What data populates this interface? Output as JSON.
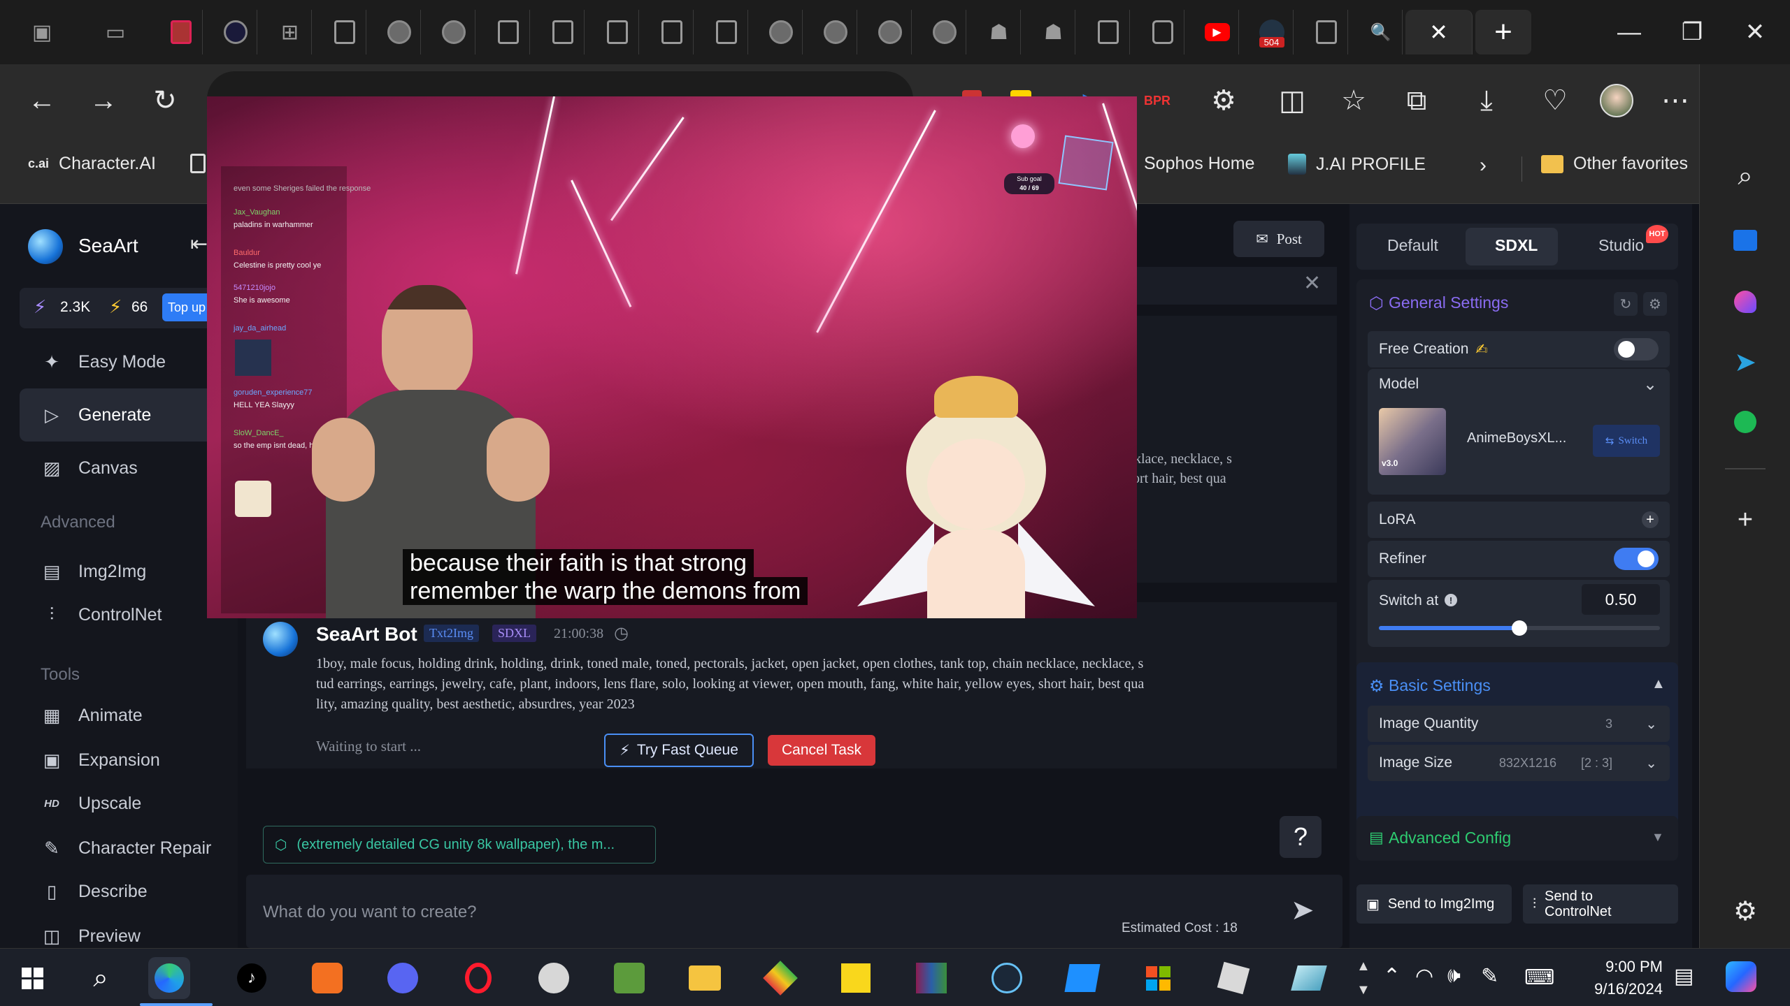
{
  "browser": {
    "favorites": {
      "character_ai": "Character.AI",
      "character_ai_short": "c.ai",
      "sophos": "Sophos Home",
      "jai_profile": "J.AI PROFILE",
      "other_favorites": "Other favorites"
    },
    "tab_badge": "504"
  },
  "seaart": {
    "brand": "SeaArt",
    "stats": {
      "energy": "2.3K",
      "stamina": "66",
      "top_up": "Top up"
    },
    "nav": {
      "easy_mode": "Easy Mode",
      "generate": "Generate",
      "canvas": "Canvas",
      "advanced_header": "Advanced",
      "img2img": "Img2Img",
      "controlnet": "ControlNet",
      "tools_header": "Tools",
      "animate": "Animate",
      "expansion": "Expansion",
      "upscale": "Upscale",
      "upscale_badge": "HD",
      "character_repair": "Character Repair",
      "describe": "Describe",
      "preview": "Preview"
    },
    "post_button": "Post",
    "prev_prompt_fragment_1": "klace, necklace, s",
    "prev_prompt_fragment_2": "ort hair, best qua",
    "message": {
      "bot_name": "SeaArt Bot",
      "tag_mode": "Txt2Img",
      "tag_model": "SDXL",
      "time": "21:00:38",
      "prompt": "1boy, male focus, holding drink, holding, drink, toned male, toned, pectorals, jacket, open jacket, open clothes, tank top, chain necklace, necklace, studs earrings, earrings, jewelry, cafe, plant, indoors, lens flare, solo, looking at viewer, open mouth, fang, white hair, yellow eyes, short hair, best quality, amazing quality, best aesthetic, absurdres, year 2023",
      "prompt_line1": "1boy, male focus, holding drink, holding, drink, toned male, toned, pectorals, jacket, open jacket, open clothes, tank top, chain necklace, necklace, s",
      "prompt_line2": "tud earrings, earrings, jewelry, cafe, plant, indoors, lens flare, solo, looking at viewer, open mouth, fang, white hair, yellow eyes, short hair, best qua",
      "prompt_line3": "lity, amazing quality, best aesthetic, absurdres, year 2023",
      "status": "Waiting to start ...",
      "fast_queue": "Try Fast Queue",
      "cancel": "Cancel Task"
    },
    "suggestion_chip": "(extremely detailed CG unity 8k wallpaper), the m...",
    "help": "?",
    "input_placeholder": "What do you want to create?",
    "estimated_cost": "Estimated Cost : 18",
    "panel": {
      "tabs": {
        "default": "Default",
        "sdxl": "SDXL",
        "studio": "Studio",
        "hot_badge": "HOT"
      },
      "general_settings": "General Settings",
      "free_creation": "Free Creation",
      "free_creation_on": false,
      "model_label": "Model",
      "model_name": "AnimeBoysXL...",
      "model_version": "v3.0",
      "switch_label": "Switch",
      "lora": "LoRA",
      "refiner": "Refiner",
      "refiner_on": true,
      "switch_at": "Switch at",
      "switch_at_value": "0.50",
      "switch_at_fraction": 0.5,
      "basic_settings": "Basic Settings",
      "image_quantity": "Image Quantity",
      "image_quantity_value": "3",
      "image_size": "Image Size",
      "image_size_value": "832X1216",
      "image_ratio": "[2 : 3]",
      "advanced_config": "Advanced Config",
      "send_img2img": "Send to Img2Img",
      "send_controlnet": "Send to ControlNet"
    }
  },
  "stream": {
    "subtitle_line1": "because their faith is that strong",
    "subtitle_line2": "remember the warp the demons from",
    "sub_goal_label": "Sub goal",
    "sub_goal_value": "40 / 69",
    "chat": [
      {
        "name": "Jax_Vaughan",
        "msg": "paladins in warhammer"
      },
      {
        "name": "Bauldur",
        "msg": "Celestine is pretty cool ye"
      },
      {
        "name": "5471210jojo",
        "msg": "She is awesome"
      },
      {
        "name": "jay_da_airhead",
        "msg": ""
      },
      {
        "name": "goruden_experience77",
        "msg": "HELL YEA Slayyy"
      },
      {
        "name": "SloW_DancE_",
        "msg": "so the emp isnt dead, he buffed her"
      }
    ],
    "chat_top": "even some Sheriges failed the response"
  },
  "taskbar": {
    "time": "9:00 PM",
    "date": "9/16/2024"
  },
  "colors": {
    "accent_blue": "#3f7cf2",
    "cancel_red": "#d8373a",
    "panel_bg": "#161922",
    "advanced_green": "#2ecc71"
  }
}
